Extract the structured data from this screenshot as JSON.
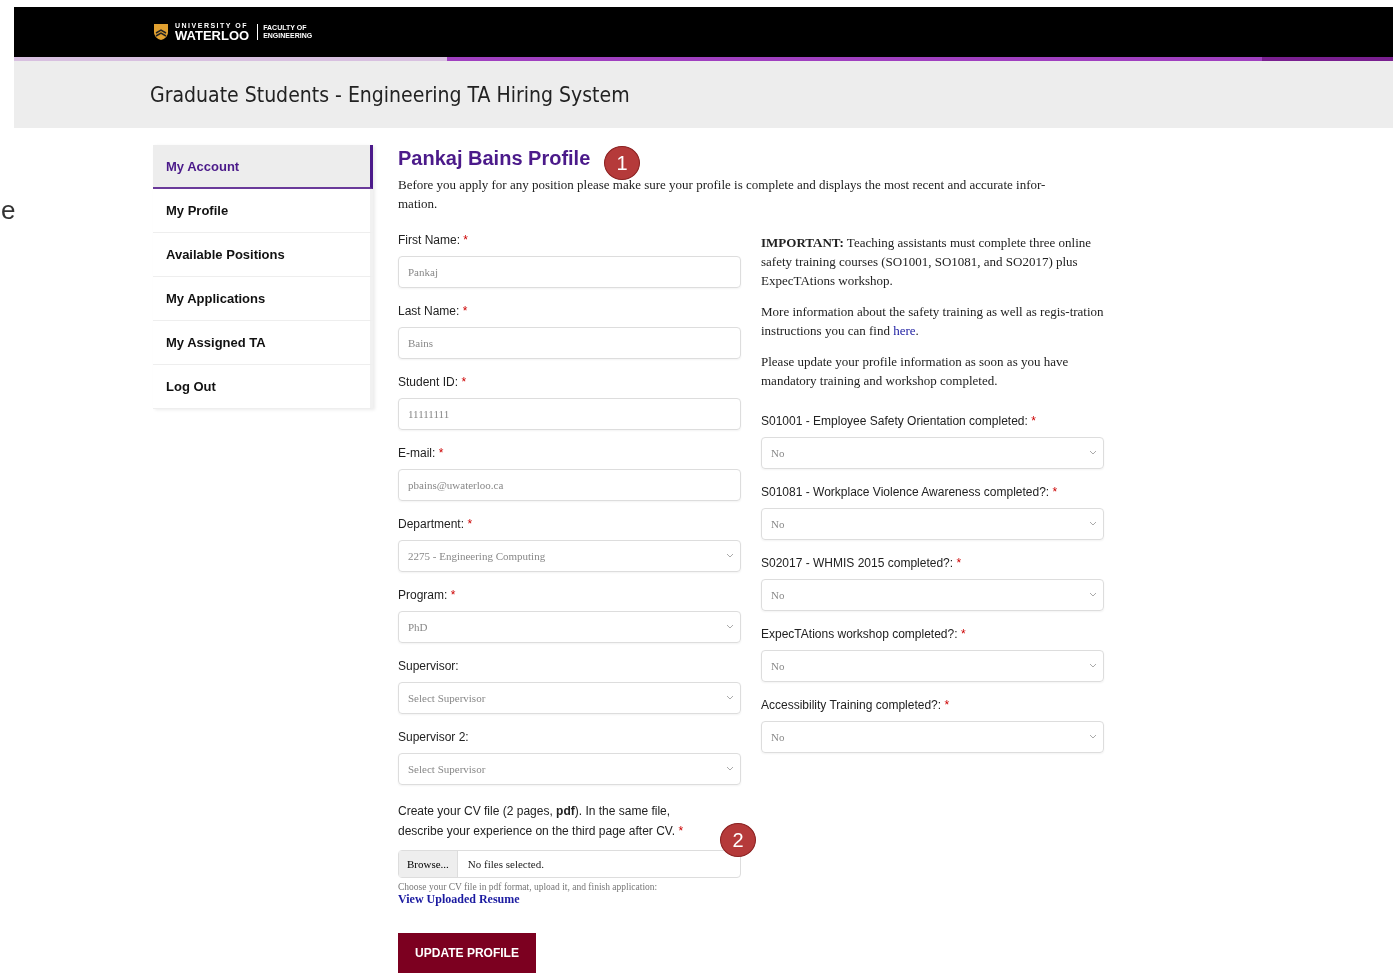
{
  "edge_text": "e",
  "header": {
    "logo_name": "WATERLOO",
    "logo_top": "UNIVERSITY OF",
    "faculty": [
      "FACULTY OF",
      "ENGINEERING"
    ]
  },
  "title": "Graduate Students - Engineering TA Hiring System",
  "sidebar": {
    "items": [
      {
        "label": "My Account",
        "selected": true
      },
      {
        "label": "My Profile",
        "selected": false
      },
      {
        "label": "Available Positions",
        "selected": false
      },
      {
        "label": "My Applications",
        "selected": false
      },
      {
        "label": "My Assigned TA",
        "selected": false
      },
      {
        "label": "Log Out",
        "selected": false
      }
    ]
  },
  "profile": {
    "heading": "Pankaj Bains Profile",
    "intro": "Before you apply for any position please make sure your profile is complete and displays the most recent and accurate infor-mation."
  },
  "left_fields": [
    {
      "kind": "input",
      "label": "First Name:",
      "required_mark": "*",
      "value": "Pankaj"
    },
    {
      "kind": "input",
      "label": "Last Name:",
      "required_mark": "*",
      "value": "Bains"
    },
    {
      "kind": "input",
      "label": "Student ID:",
      "required_mark": "*",
      "value": "11111111"
    },
    {
      "kind": "input",
      "label": "E-mail:",
      "required_mark": "*",
      "value": "pbains@uwaterloo.ca"
    },
    {
      "kind": "select",
      "label": "Department:",
      "required_mark": "*",
      "value": "2275 - Engineering Computing"
    },
    {
      "kind": "select",
      "label": "Program:",
      "required_mark": "*",
      "value": "PhD"
    },
    {
      "kind": "select",
      "label": "Supervisor:",
      "value": "Select Supervisor"
    },
    {
      "kind": "select",
      "label": "Supervisor 2:",
      "value": "Select Supervisor"
    }
  ],
  "cv": {
    "label": "Create your CV file (2 pages, **pdf**). In the same file, describe your experience on the third page after CV.",
    "required_mark": "*",
    "browse": "Browse...",
    "file_status": "No files selected.",
    "hint": "Choose your CV file in pdf format, upload it, and finish application:",
    "link": "View Uploaded Resume"
  },
  "submit": "UPDATE PROFILE",
  "notice": [
    {
      "text": "**IMPORTANT:** Teaching assistants must complete three online safety training courses (SO1001, SO1081, and SO2017) plus ExpecTAtions workshop."
    },
    {
      "text": "More information about the safety training as well as regis-tration instructions you can find",
      "link": "here",
      "after": "."
    },
    {
      "text": "Please update your profile information as soon as you have mandatory training and workshop completed."
    }
  ],
  "right_fields": [
    {
      "kind": "select",
      "label": "S01001 - Employee Safety Orientation completed:",
      "required_mark": "*",
      "value": "No"
    },
    {
      "kind": "select",
      "label": "S01081 - Workplace Violence Awareness completed?:",
      "required_mark": "*",
      "value": "No"
    },
    {
      "kind": "select",
      "label": "S02017 - WHMIS 2015 completed?:",
      "required_mark": "*",
      "value": "No"
    },
    {
      "kind": "select",
      "label": "ExpecTAtions workshop completed?:",
      "required_mark": "*",
      "value": "No"
    },
    {
      "kind": "select",
      "label": "Accessibility Training completed?:",
      "required_mark": "*",
      "value": "No"
    }
  ],
  "annotations": [
    "1",
    "2"
  ]
}
